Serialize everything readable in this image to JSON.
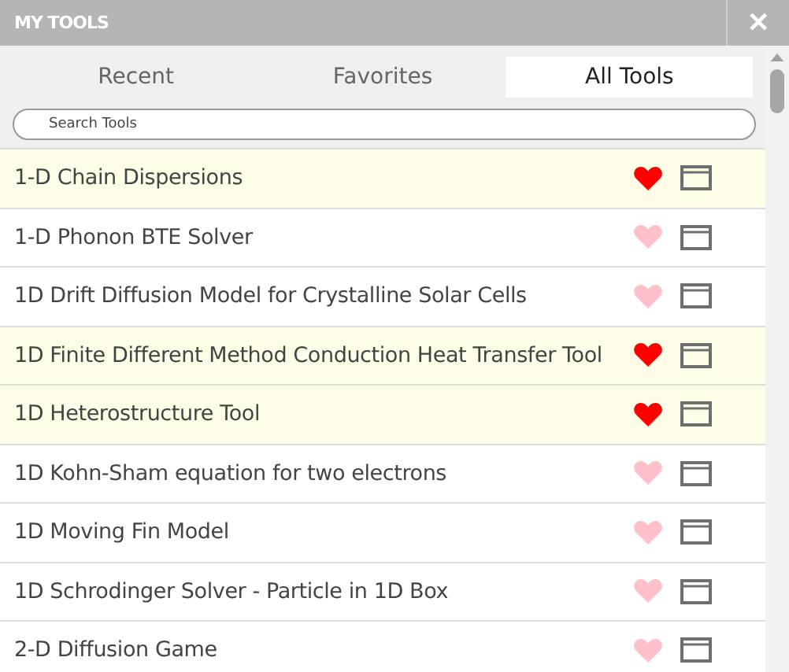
{
  "header": {
    "title": "MY TOOLS",
    "close": "✕"
  },
  "tabs": [
    {
      "label": "Recent",
      "selected": false
    },
    {
      "label": "Favorites",
      "selected": false
    },
    {
      "label": "All Tools",
      "selected": true
    }
  ],
  "search": {
    "placeholder": "Search Tools"
  },
  "tools": [
    {
      "name": "1-D Chain Dispersions",
      "favorite": true
    },
    {
      "name": "1-D Phonon BTE Solver",
      "favorite": false
    },
    {
      "name": "1D Drift Diffusion Model for Crystalline Solar Cells",
      "favorite": false
    },
    {
      "name": "1D Finite Different Method Conduction Heat Transfer Tool",
      "favorite": true
    },
    {
      "name": "1D Heterostructure Tool",
      "favorite": true
    },
    {
      "name": "1D Kohn-Sham equation for two electrons",
      "favorite": false
    },
    {
      "name": "1D Moving Fin Model",
      "favorite": false
    },
    {
      "name": "1D Schrodinger Solver - Particle in 1D Box",
      "favorite": false
    },
    {
      "name": "2-D Diffusion Game",
      "favorite": false
    }
  ]
}
